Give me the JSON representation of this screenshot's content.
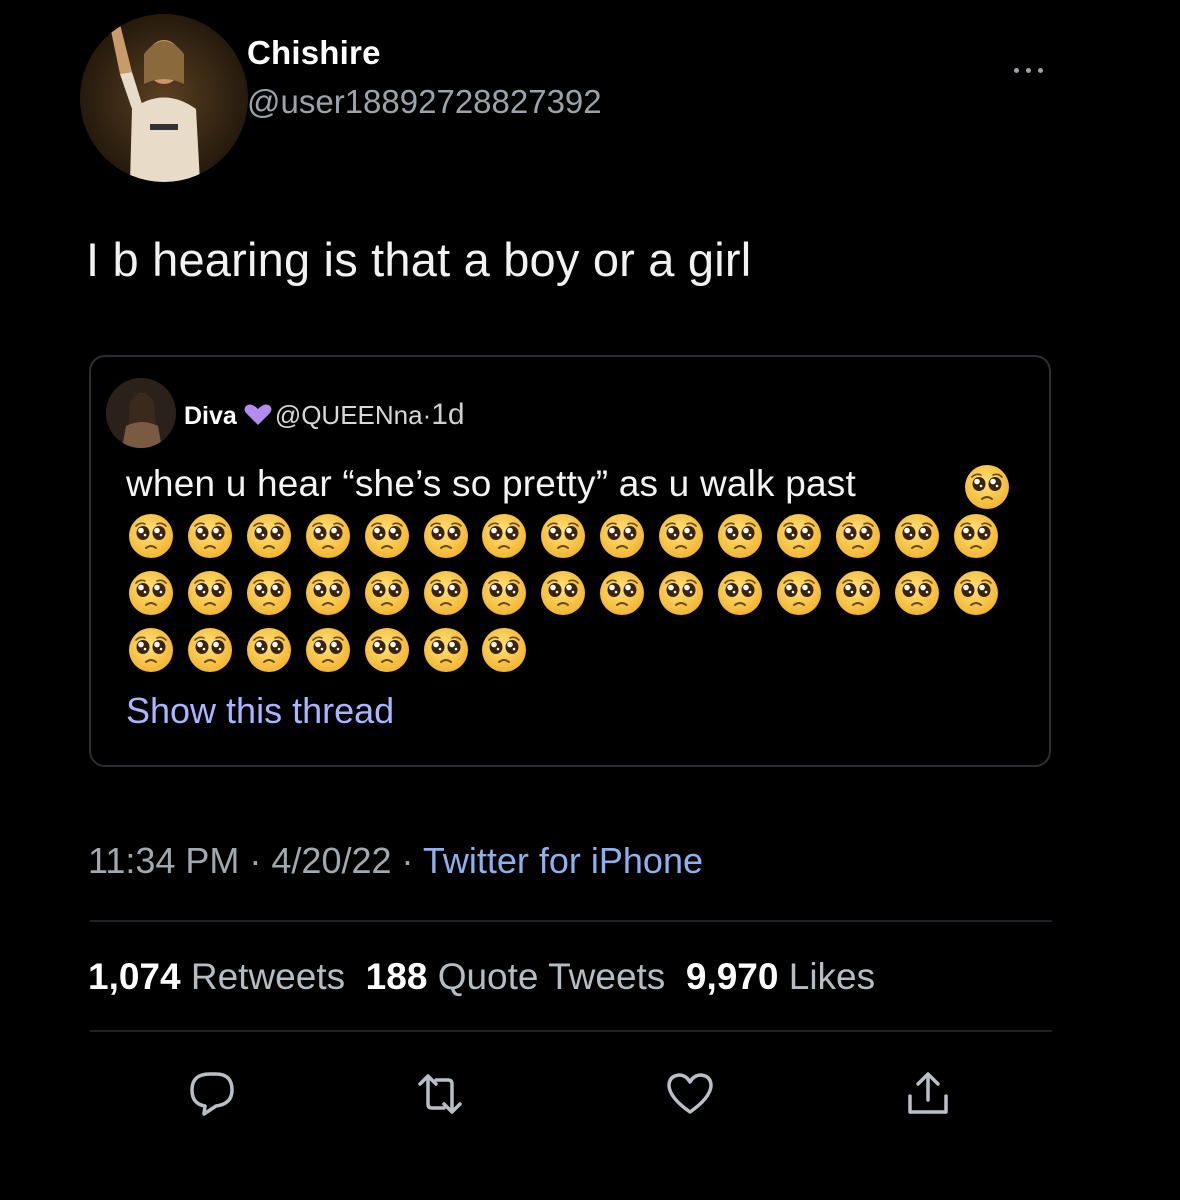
{
  "tweet": {
    "display_name": "Chishire",
    "handle": "@user188927288273​92",
    "text": "I b hearing is that a boy or a girl",
    "timestamp": "11:34 PM · 4/20/22 · ",
    "source": "Twitter for iPhone"
  },
  "quote": {
    "name": "Diva",
    "handle": "@QUEENna·",
    "time": " 1d",
    "text": "when u hear “she’s so pretty” as u walk past",
    "emoji_count": 38,
    "emoji_icon": "pleading-face-emoji",
    "show_thread": "Show this thread"
  },
  "stats": {
    "retweets_count": "1,074",
    "retweets_label": "Retweets",
    "quotes_count": "188",
    "quotes_label": "Quote Tweets",
    "likes_count": "9,970",
    "likes_label": "Likes"
  },
  "actions": [
    "reply-icon",
    "retweet-icon",
    "like-icon",
    "share-icon"
  ],
  "colors": {
    "background": "#000000",
    "link": "#aab4ff",
    "source": "#8fb0f0",
    "heart": "#b48cf0"
  }
}
